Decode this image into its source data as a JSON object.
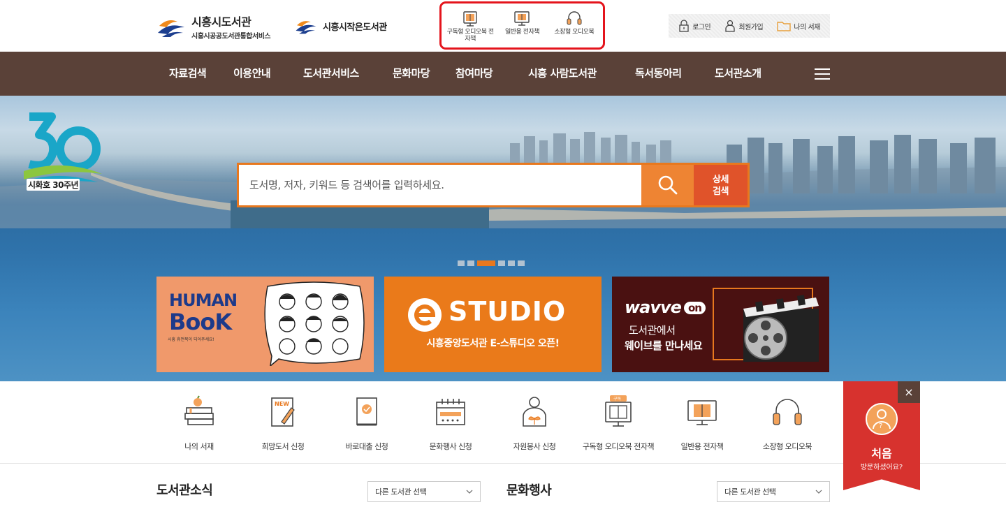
{
  "header": {
    "logo_title": "시흥시도서관",
    "logo_subtitle": "시흥시공공도서관통합서비스",
    "logo2_title": "시흥시작은도서관",
    "ebook_links": [
      {
        "label": "구독형 오디오북 전자책"
      },
      {
        "label": "일반용 전자책"
      },
      {
        "label": "소장형 오디오북"
      }
    ],
    "util": {
      "login": "로그인",
      "join": "회원가입",
      "my_shelf": "나의 서재"
    }
  },
  "gnb": {
    "items": [
      "자료검색",
      "이용안내",
      "도서관서비스",
      "문화마당",
      "참여마당",
      "시흥 사람도서관",
      "독서동아리",
      "도서관소개"
    ]
  },
  "hero": {
    "anniversary_label": "시화호 30주년",
    "search_placeholder": "도서명, 저자, 키워드 등 검색어를 입력하세요.",
    "detail_search": "상세\n검색",
    "detail_search_line1": "상세",
    "detail_search_line2": "검색",
    "banners": {
      "human": {
        "title1": "HUMAN",
        "title2": "BooK",
        "caption": "시흥 휴먼북이 되어주세요!"
      },
      "estudio": {
        "logo": "STUDIO",
        "caption": "시흥중앙도서관 E-스튜디오 오픈!"
      },
      "wavve": {
        "logo": "wavve",
        "on": "on",
        "line1": "도서관에서",
        "line2": "웨이브를 만나세요"
      }
    }
  },
  "quick_menu": [
    {
      "label": "나의 서재"
    },
    {
      "label": "희망도서 신청"
    },
    {
      "label": "바로대출 신청"
    },
    {
      "label": "문화행사 신청"
    },
    {
      "label": "자원봉사 신청"
    },
    {
      "label": "구독형 오디오북 전자책",
      "badge": "구독"
    },
    {
      "label": "일반용 전자책"
    },
    {
      "label": "소장형 오디오북"
    }
  ],
  "first_visit": {
    "title": "처음",
    "subtitle": "방문하셨어요?",
    "close": "×"
  },
  "sections": {
    "news_title": "도서관소식",
    "news_select": "다른 도서관 선택",
    "events_title": "문화행사",
    "events_select": "다른 도서관 선택"
  },
  "colors": {
    "nav_bg": "#5a4138",
    "accent_orange": "#ee8433",
    "detail_red": "#e0532a",
    "highlight_red": "#e4141c",
    "first_visit_red": "#d7322e"
  }
}
